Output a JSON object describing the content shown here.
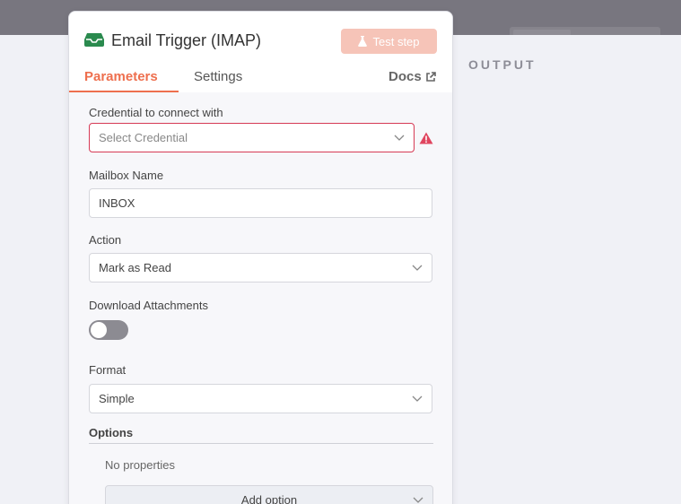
{
  "panel": {
    "title": "Email Trigger (IMAP)",
    "test_step_label": "Test step",
    "tabs": [
      "Parameters",
      "Settings"
    ],
    "docs_label": "Docs"
  },
  "output": {
    "label": "OUTPUT"
  },
  "fields": {
    "credential": {
      "label": "Credential to connect with",
      "placeholder": "Select Credential"
    },
    "mailbox": {
      "label": "Mailbox Name",
      "value": "INBOX"
    },
    "action": {
      "label": "Action",
      "value": "Mark as Read"
    },
    "attachments": {
      "label": "Download Attachments",
      "enabled": false
    },
    "format": {
      "label": "Format",
      "value": "Simple"
    }
  },
  "options": {
    "label": "Options",
    "empty_text": "No properties",
    "add_label": "Add option"
  },
  "colors": {
    "accent": "#ee6f4e",
    "error": "#d63a55",
    "node_icon": "#2a8a4e"
  }
}
